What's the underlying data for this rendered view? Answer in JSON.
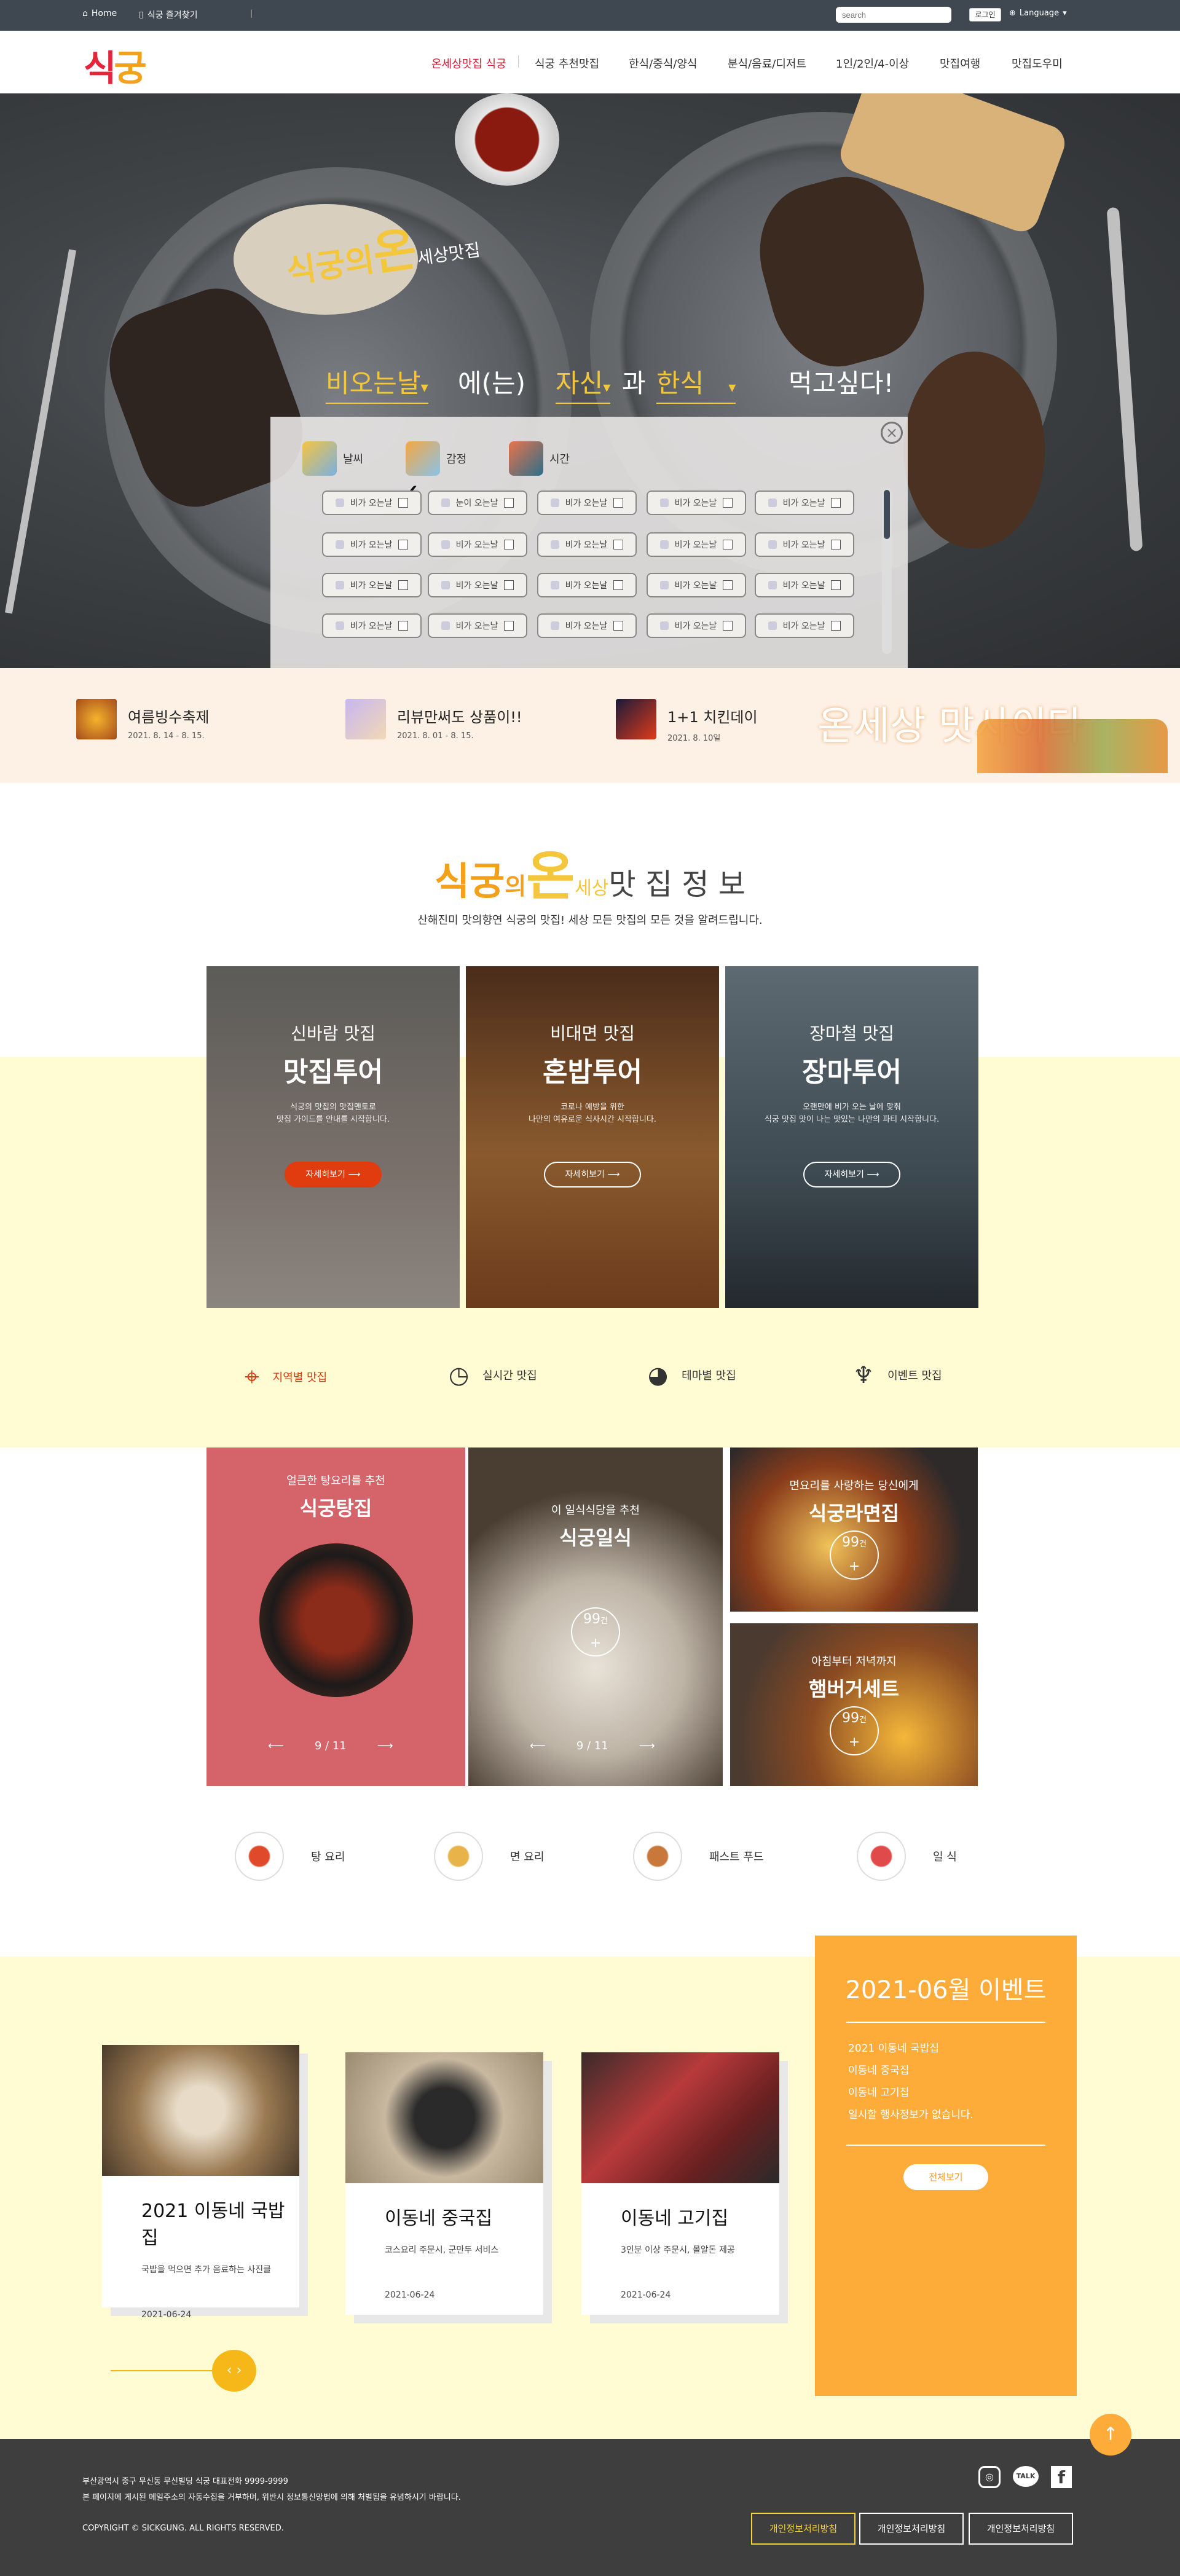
{
  "topbar": {
    "home": "Home",
    "bookmark": "식궁 즐겨찾기",
    "separator": "ǀ",
    "search_placeholder": "search",
    "login": "로그인",
    "language": "Language"
  },
  "logo": {
    "first": "식",
    "second": "궁"
  },
  "nav": [
    "온세상맛집 식궁",
    "식궁 추천맛집",
    "한식/중식/양식",
    "분식/음료/디저트",
    "1인/2인/4-이상",
    "맛집여행",
    "맛집도우미"
  ],
  "hero": {
    "title_main": "식궁의",
    "title_on": "온",
    "title_rest": "세상맛집",
    "sentence": {
      "s1": "비오는날",
      "s1_arrow": "▾",
      "s2": "에(는)",
      "s3": "자신",
      "s3_arrow": "▾",
      "s4": "과",
      "s5": "한식",
      "s5_arrow": "▾",
      "s6": "먹고싶다!"
    }
  },
  "panel": {
    "tabs": [
      "날씨",
      "감정",
      "시간"
    ],
    "check_mark": "✓",
    "close": "×",
    "pills": [
      [
        "비가 오는날",
        "눈이 오는날",
        "비가 오는날",
        "비가 오는날",
        "비가 오는날"
      ],
      [
        "비가 오는날",
        "비가 오는날",
        "비가 오는날",
        "비가 오는날",
        "비가 오는날"
      ],
      [
        "비가 오는날",
        "비가 오는날",
        "비가 오는날",
        "비가 오는날",
        "비가 오는날"
      ],
      [
        "비가 오는날",
        "비가 오는날",
        "비가 오는날",
        "비가 오는날",
        "비가 오는날"
      ]
    ]
  },
  "promos": [
    {
      "title": "여름빙수축제",
      "date": "2021. 8. 14 - 8. 15."
    },
    {
      "title": "리뷰만써도 상품이!!",
      "date": "2021. 8. 01 - 8. 15."
    },
    {
      "title": "1+1 치킨데이",
      "date": "2021. 8. 10일"
    }
  ],
  "village_text": "온세상 맛사이다",
  "section": {
    "title_a": "식궁",
    "title_b": "의",
    "title_c": "온",
    "title_d": "세상",
    "title_e": "맛 집 정 보",
    "subtitle": "산해진미 맛의향연 식궁의 맛집! 세상 모든 맛집의 모든 것을 알려드립니다."
  },
  "tours": [
    {
      "sub": "신바람 맛집",
      "title": "맛집투어",
      "desc": "식궁의 맛집의 맛집멘토로\n맛집 가이드를 안내를 시작합니다.",
      "btn": "자세히보기",
      "arrow": "⟶"
    },
    {
      "sub": "비대면 맛집",
      "title": "혼밥투어",
      "desc": "코로나 예방을 위한\n나만의 여유로운 식사시간 시작합니다.",
      "btn": "자세히보기",
      "arrow": "⟶"
    },
    {
      "sub": "장마철 맛집",
      "title": "장마투어",
      "desc": "오랜만에 비가 오는 날에 맞춰\n식궁 맛집 맛이 나는 맛있는 나만의 파티 시작합니다.",
      "btn": "자세히보기",
      "arrow": "⟶"
    }
  ],
  "categories": [
    "지역별 맛집",
    "실시간 맛집",
    "테마별 맛집",
    "이벤트 맛집"
  ],
  "gallery": {
    "tang": {
      "sub": "얼큰한 탕요리를 추천",
      "title": "식궁탕집",
      "pager": "9 / 11"
    },
    "il": {
      "sub": "이 일식식당을 추천",
      "title": "식궁일식",
      "badge": "99",
      "badge_unit": "건",
      "plus": "+",
      "pager": "9 / 11"
    },
    "ramen": {
      "sub": "면요리를 사랑하는 당신에게",
      "title": "식궁라면집",
      "badge": "99",
      "badge_unit": "건",
      "plus": "+"
    },
    "burger": {
      "sub": "아침부터 저녁까지",
      "title": "햄버거세트",
      "badge": "99",
      "badge_unit": "건",
      "plus": "+"
    },
    "prev": "⟵",
    "next": "⟶"
  },
  "food_categories": [
    "탕 요리",
    "면 요리",
    "패스트 푸드",
    "일 식"
  ],
  "events": [
    {
      "title": "2021 이동네 국밥집",
      "desc": "국밥을 먹으면 추가 음료하는 사진클",
      "date": "2021-06-24"
    },
    {
      "title": "이동네 중국집",
      "desc": "코스요리 주문시, 군만두 서비스",
      "date": "2021-06-24"
    },
    {
      "title": "이동네 고기집",
      "desc": "3인분 이상 주문시, 몰알돈 제공",
      "date": "2021-06-24"
    }
  ],
  "event_nav": "‹ ›",
  "event_box": {
    "title": "2021-06월 이벤트",
    "items": [
      "2021 이동네 국밥집",
      "이동네 중국집",
      "이동네 고기집",
      "일시할 행사정보가 없습니다."
    ],
    "button": "전체보기"
  },
  "footer": {
    "line1": "부산광역시 중구 무신동 무신빌딩  식궁  대표전화 9999-9999",
    "line2": "본 페이지에 게시된 메일주소의 자동수집을 거부하며, 위반시 정보통신망법에 의해 처벌됨을 유념하시기 바랍니다.",
    "copyright": "COPYRIGHT © SICKGUNG. ALL RIGHTS RESERVED.",
    "buttons": [
      "개인정보처리방침",
      "개인정보처리방침",
      "개인정보처리방침"
    ],
    "talk": "TALK"
  },
  "totop": "↑",
  "colors": {
    "accent": "#fdab39",
    "red": "#e13b10",
    "yellow": "#fffbd3",
    "dark": "#3e3e3e"
  }
}
